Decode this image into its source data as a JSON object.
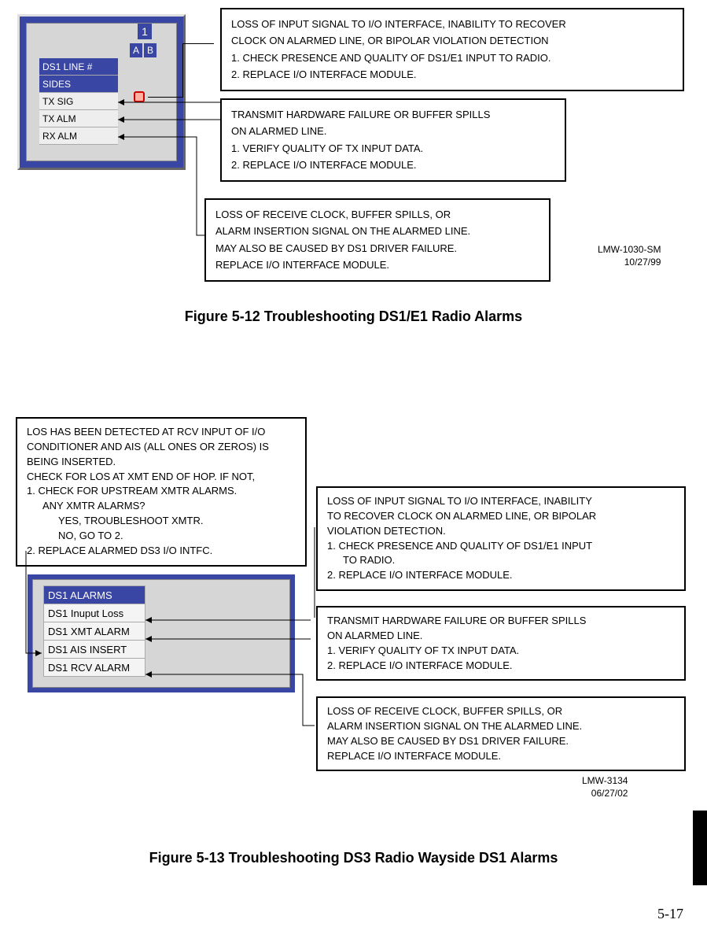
{
  "fig512": {
    "panel": {
      "badge1": "1",
      "badgeA": "A",
      "badgeB": "B",
      "rows": {
        "r0": "DS1 LINE #",
        "r1": "SIDES",
        "r2": "TX SIG",
        "r3": "TX ALM",
        "r4": "RX ALM"
      }
    },
    "callout1": {
      "l1": "LOSS OF INPUT SIGNAL TO I/O INTERFACE, INABILITY TO RECOVER",
      "l2": "CLOCK ON ALARMED LINE, OR BIPOLAR VIOLATION DETECTION",
      "l3": "1.  CHECK PRESENCE AND QUALITY OF DS1/E1 INPUT TO RADIO.",
      "l4": "2.  REPLACE I/O INTERFACE MODULE."
    },
    "callout2": {
      "l1": "TRANSMIT HARDWARE FAILURE OR BUFFER SPILLS",
      "l2": "ON ALARMED LINE.",
      "l3": "1.    VERIFY QUALITY OF TX INPUT DATA.",
      "l4": "2.    REPLACE I/O INTERFACE MODULE."
    },
    "callout3": {
      "l1": "LOSS OF RECEIVE CLOCK, BUFFER SPILLS, OR",
      "l2": "ALARM INSERTION SIGNAL ON THE ALARMED LINE.",
      "l3": "MAY ALSO BE CAUSED BY DS1 DRIVER FAILURE.",
      "l4": "REPLACE I/O INTERFACE MODULE."
    },
    "docnum": {
      "a": "LMW-1030-SM",
      "b": "10/27/99"
    },
    "caption": "Figure 5-12  Troubleshooting DS1/E1 Radio Alarms"
  },
  "fig513": {
    "callout4": {
      "l1": "LOS HAS BEEN DETECTED AT RCV INPUT OF I/O",
      "l2": "CONDITIONER AND AIS (ALL ONES OR ZEROS) IS",
      "l3": "BEING INSERTED.",
      "l4": "CHECK FOR LOS AT XMT END OF HOP. IF NOT,",
      "l5": "1.   CHECK FOR UPSTREAM XMTR ALARMS.",
      "l6": "ANY XMTR ALARMS?",
      "l7": "YES, TROUBLESHOOT XMTR.",
      "l8": "NO, GO TO 2.",
      "l9": "2.   REPLACE ALARMED DS3 I/O INTFC."
    },
    "callout5": {
      "l1": "LOSS OF INPUT SIGNAL TO I/O INTERFACE, INABILITY",
      "l2": "TO RECOVER CLOCK ON ALARMED LINE, OR BIPOLAR",
      "l3": "VIOLATION DETECTION.",
      "l4": "1.   CHECK PRESENCE AND QUALITY OF DS1/E1 INPUT",
      "l5": "TO RADIO.",
      "l6": "2.   REPLACE I/O INTERFACE MODULE."
    },
    "callout6": {
      "l1": "TRANSMIT HARDWARE FAILURE OR BUFFER SPILLS",
      "l2": "ON ALARMED LINE.",
      "l3": "1.   VERIFY QUALITY OF TX INPUT DATA.",
      "l4": "2.   REPLACE I/O INTERFACE MODULE."
    },
    "callout7": {
      "l1": "LOSS OF RECEIVE CLOCK, BUFFER SPILLS, OR",
      "l2": "ALARM INSERTION SIGNAL ON THE ALARMED LINE.",
      "l3": "MAY ALSO BE CAUSED BY DS1 DRIVER FAILURE.",
      "l4": "REPLACE I/O INTERFACE MODULE."
    },
    "panel": {
      "rows": {
        "r0": "DS1 ALARMS",
        "r1": "DS1 Inuput Loss",
        "r2": "DS1 XMT ALARM",
        "r3": "DS1 AIS INSERT",
        "r4": "DS1 RCV ALARM"
      }
    },
    "docnum": {
      "a": "LMW-3134",
      "b": "06/27/02"
    },
    "caption": "Figure 5-13  Troubleshooting DS3 Radio Wayside DS1 Alarms"
  },
  "pagenum": "5-17"
}
